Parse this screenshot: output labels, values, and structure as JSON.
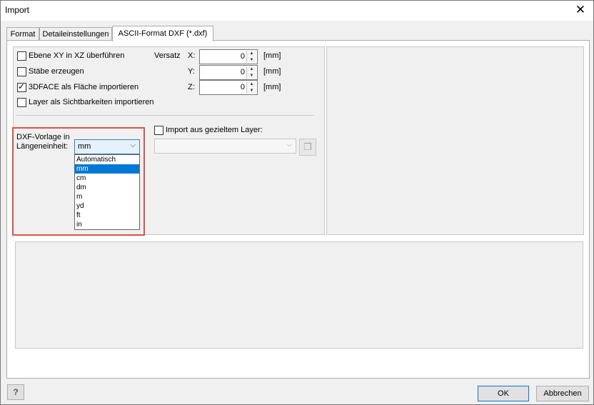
{
  "window": {
    "title": "Import",
    "close_glyph": "✕"
  },
  "tabs": [
    {
      "label": "Format"
    },
    {
      "label": "Detaileinstellungen"
    },
    {
      "label": "ASCII-Format DXF (*.dxf)"
    }
  ],
  "options": {
    "ebene_xy": {
      "label": "Ebene XY in XZ überführen",
      "checked": false
    },
    "staebe": {
      "label": "Stäbe erzeugen",
      "checked": false
    },
    "face3d": {
      "label": "3DFACE als Fläche importieren",
      "checked": true
    },
    "layer_sicht": {
      "label": "Layer als Sichtbarkeiten importieren",
      "checked": false
    }
  },
  "versatz": {
    "label": "Versatz",
    "x": {
      "label": "X:",
      "value": "0",
      "unit": "[mm]"
    },
    "y": {
      "label": "Y:",
      "value": "0",
      "unit": "[mm]"
    },
    "z": {
      "label": "Z:",
      "value": "0",
      "unit": "[mm]"
    }
  },
  "dxf_vorlage": {
    "label_line1": "DXF-Vorlage in",
    "label_line2": "Längeneinheit:",
    "selected": "mm",
    "options": [
      "Automatisch",
      "mm",
      "cm",
      "dm",
      "m",
      "yd",
      "ft",
      "in"
    ]
  },
  "import_layer": {
    "label": "Import aus gezieltem Layer:",
    "checked": false,
    "value": ""
  },
  "buttons": {
    "ok": "OK",
    "cancel": "Abbrechen",
    "help": "?"
  },
  "icons": [
    "close-icon",
    "spin-up-icon",
    "spin-down-icon",
    "chevron-down-icon",
    "layer-picker-icon",
    "help-icon"
  ]
}
